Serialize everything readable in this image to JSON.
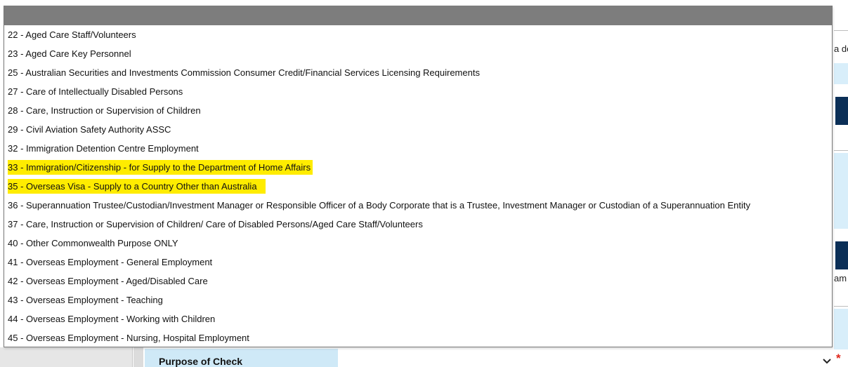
{
  "dropdown": {
    "options": [
      {
        "label": "22 - Aged Care Staff/Volunteers",
        "highlighted": false
      },
      {
        "label": "23 - Aged Care Key Personnel",
        "highlighted": false
      },
      {
        "label": "25 - Australian Securities and Investments Commission Consumer Credit/Financial Services Licensing Requirements",
        "highlighted": false
      },
      {
        "label": "27 - Care of Intellectually Disabled Persons",
        "highlighted": false
      },
      {
        "label": "28 - Care, Instruction or Supervision of Children",
        "highlighted": false
      },
      {
        "label": "29 - Civil Aviation Safety Authority ASSC",
        "highlighted": false
      },
      {
        "label": "32 - Immigration Detention Centre Employment",
        "highlighted": false
      },
      {
        "label": "33 - Immigration/Citizenship - for Supply to the Department of Home Affairs",
        "highlighted": true
      },
      {
        "label": "35 - Overseas Visa - Supply to a Country Other than Australia",
        "highlighted": true
      },
      {
        "label": "36 - Superannuation Trustee/Custodian/Investment Manager or Responsible Officer of a Body Corporate that is a Trustee, Investment Manager or Custodian of a Superannuation Entity",
        "highlighted": false
      },
      {
        "label": "37 - Care, Instruction or Supervision of Children/ Care of Disabled Persons/Aged Care Staff/Volunteers",
        "highlighted": false
      },
      {
        "label": "40 - Other Commonwealth Purpose ONLY",
        "highlighted": false
      },
      {
        "label": "41 - Overseas Employment - General Employment",
        "highlighted": false
      },
      {
        "label": "42 - Overseas Employment - Aged/Disabled Care",
        "highlighted": false
      },
      {
        "label": "43 - Overseas Employment - Teaching",
        "highlighted": false
      },
      {
        "label": "44 - Overseas Employment - Working with Children",
        "highlighted": false
      },
      {
        "label": "45 - Overseas Employment - Nursing, Hospital Employment",
        "highlighted": false
      }
    ],
    "highlight_color": "#ffec00"
  },
  "form": {
    "purpose_label": "Purpose of Check",
    "required_marker": "*",
    "required_color": "#e0261b",
    "chevron_icon": "chevron-down-icon"
  },
  "background": {
    "edge_text_1": "a de",
    "edge_text_2": "am",
    "dark_bar_color": "#0b2f57",
    "light_panel_color": "#d8eefa"
  }
}
